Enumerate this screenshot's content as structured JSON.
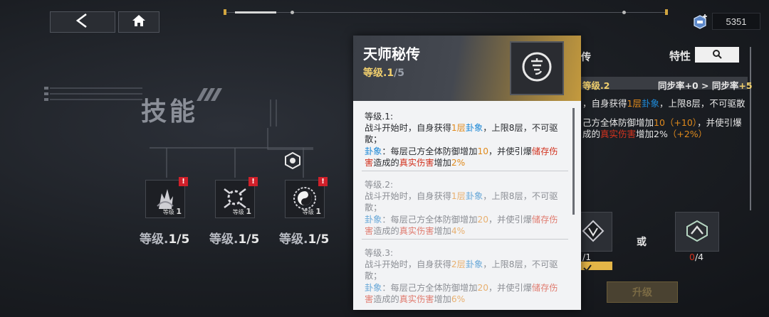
{
  "topbar": {
    "back_icon": "chevron-left-icon",
    "home_icon": "home-icon",
    "currency_icon": "crystal-icon",
    "currency_value": "5351"
  },
  "skills": {
    "title": "技能",
    "items": [
      {
        "icon": "lightning-fist-icon",
        "badge": "!",
        "level_label": "等级",
        "level_num": "1",
        "level_text_prefix": "等级.",
        "level_text_value": "1/5"
      },
      {
        "icon": "scroll-burst-icon",
        "badge": "!",
        "level_label": "等级",
        "level_num": "1",
        "level_text_prefix": "等级.",
        "level_text_value": "1/5"
      },
      {
        "icon": "yin-yang-icon",
        "badge": "!",
        "level_label": "等级",
        "level_num": "1",
        "level_text_prefix": "等级.",
        "level_text_value": "1/5"
      }
    ]
  },
  "popup": {
    "title": "天师秘传",
    "level_prefix": "等级.",
    "level_cur": "1",
    "level_max": "/5",
    "icon": "sigil-icon",
    "levels": [
      {
        "head": "等级.1:",
        "l1a": "战斗开始时，自身获得",
        "l1b": "1层",
        "l1c": "卦象",
        "l1d": "，上限8层，不可驱散；",
        "l2a": "卦象",
        "l2b": "：每层己方全体防御增加",
        "l2c": "10",
        "l2d": "，并使引爆",
        "l2e": "储存伤害",
        "l2f": "造成的",
        "l2g": "真实伤害",
        "l2h": "增加",
        "l2i": "2%"
      },
      {
        "head": "等级.2:",
        "l1a": "战斗开始时，自身获得",
        "l1b": "1层",
        "l1c": "卦象",
        "l1d": "，上限8层，不可驱散；",
        "l2a": "卦象",
        "l2b": "：每层己方全体防御增加",
        "l2c": "20",
        "l2d": "，并使引爆",
        "l2e": "储存伤害",
        "l2f": "造成的",
        "l2g": "真实伤害",
        "l2h": "增加",
        "l2i": "4%"
      },
      {
        "head": "等级.3:",
        "l1a": "战斗开始时，自身获得",
        "l1b": "2层",
        "l1c": "卦象",
        "l1d": "，上限8层，不可驱散；",
        "l2a": "卦象",
        "l2b": "：每层己方全体防御增加",
        "l2c": "20",
        "l2d": "，并使引爆",
        "l2e": "储存伤害",
        "l2f": "造成的",
        "l2g": "真实伤害",
        "l2h": "增加",
        "l2i": "6%"
      }
    ]
  },
  "right_panel": {
    "partial_title": "传",
    "trait_label": "特性",
    "search_icon": "search-icon",
    "level_text": "等级.2",
    "sync_label": "同步率",
    "sync_from": "+0",
    "arrow": ">",
    "sync_label2": "同步率",
    "sync_to": "+5",
    "desc1a": "，自身获得",
    "desc1b": "1层",
    "desc1c": "卦象",
    "desc1d": "，上限8层，不可驱散",
    "desc2a": "己方全体防御增加",
    "desc2b": "10",
    "desc2c": "（+10）",
    "desc2d": "，并使引爆",
    "desc3a": "成的",
    "desc3b": "真实伤害",
    "desc3c": "增加2%",
    "desc3d": "（+2%）",
    "item1_count": "/1",
    "item1_check": "checkmark-icon",
    "or_label": "或",
    "item2_count_have": "0",
    "item2_count_need": "/4",
    "upgrade_label": "升级"
  },
  "colors": {
    "accent_gold": "#f2d06e",
    "orange": "#e08a1c",
    "blue": "#1e89d6",
    "red": "#d2321e"
  }
}
